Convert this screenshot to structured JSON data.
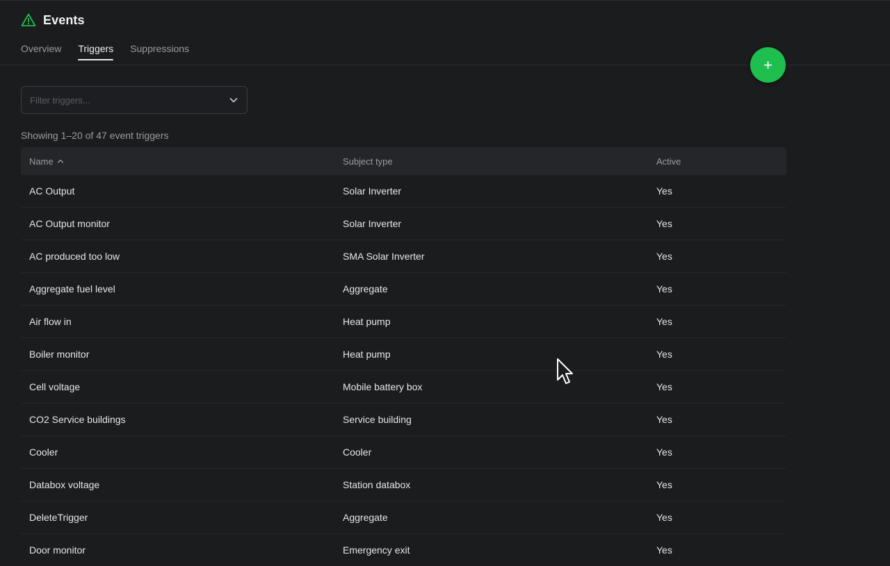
{
  "header": {
    "title": "Events",
    "icon": "warning-triangle-icon",
    "accent": "#1fbf4f"
  },
  "tabs": [
    {
      "label": "Overview",
      "active": false
    },
    {
      "label": "Triggers",
      "active": true
    },
    {
      "label": "Suppressions",
      "active": false
    }
  ],
  "fab": {
    "label": "+",
    "color": "#1fbf4f"
  },
  "filter": {
    "placeholder": "Filter triggers...",
    "value": ""
  },
  "summary": "Showing 1–20 of 47 event triggers",
  "table": {
    "columns": {
      "name": "Name",
      "subject": "Subject type",
      "active": "Active"
    },
    "sort": {
      "column": "name",
      "direction": "ascending"
    },
    "rows": [
      {
        "name": "AC Output",
        "subject": "Solar Inverter",
        "active": "Yes"
      },
      {
        "name": "AC Output monitor",
        "subject": "Solar Inverter",
        "active": "Yes"
      },
      {
        "name": "AC produced too low",
        "subject": "SMA Solar Inverter",
        "active": "Yes"
      },
      {
        "name": "Aggregate fuel level",
        "subject": "Aggregate",
        "active": "Yes"
      },
      {
        "name": "Air flow in",
        "subject": "Heat pump",
        "active": "Yes"
      },
      {
        "name": "Boiler monitor",
        "subject": "Heat pump",
        "active": "Yes"
      },
      {
        "name": "Cell voltage",
        "subject": "Mobile battery box",
        "active": "Yes"
      },
      {
        "name": "CO2 Service buildings",
        "subject": "Service building",
        "active": "Yes"
      },
      {
        "name": "Cooler",
        "subject": "Cooler",
        "active": "Yes"
      },
      {
        "name": "Databox voltage",
        "subject": "Station databox",
        "active": "Yes"
      },
      {
        "name": "DeleteTrigger",
        "subject": "Aggregate",
        "active": "Yes"
      },
      {
        "name": "Door monitor",
        "subject": "Emergency exit",
        "active": "Yes"
      }
    ]
  }
}
